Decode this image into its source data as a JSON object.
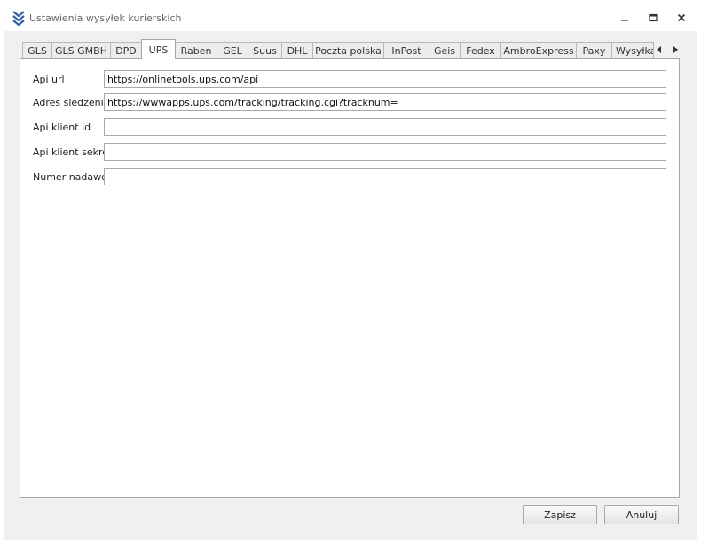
{
  "window": {
    "title": "Ustawienia wysyłek kurierskich",
    "icon": "double-chevron-down-logo-icon",
    "controls": [
      "minimize-icon",
      "maximize-icon",
      "close-icon"
    ]
  },
  "tabs": [
    {
      "label": "GLS",
      "active": false
    },
    {
      "label": "GLS GMBH",
      "active": false
    },
    {
      "label": "DPD",
      "active": false
    },
    {
      "label": "UPS",
      "active": true
    },
    {
      "label": "Raben",
      "active": false
    },
    {
      "label": "GEL",
      "active": false
    },
    {
      "label": "Suus",
      "active": false
    },
    {
      "label": "DHL",
      "active": false
    },
    {
      "label": "Poczta polska",
      "active": false
    },
    {
      "label": "InPost",
      "active": false
    },
    {
      "label": "Geis",
      "active": false
    },
    {
      "label": "Fedex",
      "active": false
    },
    {
      "label": "AmbroExpress",
      "active": false
    },
    {
      "label": "Paxy",
      "active": false
    },
    {
      "label": "Wysyłka",
      "active": false
    }
  ],
  "tab_scroll": {
    "left_icon": "arrow-left-icon",
    "right_icon": "arrow-right-icon"
  },
  "form": {
    "fields": [
      {
        "label": "Api url",
        "value": "https://onlinetools.ups.com/api"
      },
      {
        "label": "Adres śledzenia",
        "value": "https://wwwapps.ups.com/tracking/tracking.cgi?tracknum="
      },
      {
        "label": "Api klient id",
        "value": ""
      },
      {
        "label": "Api klient sekret",
        "value": ""
      },
      {
        "label": "Numer nadawcy",
        "value": ""
      }
    ]
  },
  "buttons": {
    "save": "Zapisz",
    "cancel": "Anuluj"
  },
  "colors": {
    "logo": "#2f5fa0",
    "window_bg": "#f0f0f0",
    "panel_bg": "#ffffff",
    "border": "#a8a8a8"
  }
}
